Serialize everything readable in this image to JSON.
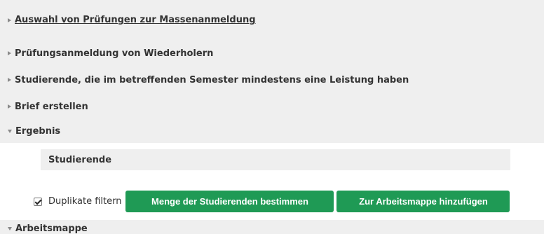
{
  "sections": [
    {
      "label": "Auswahl von Prüfungen zur Massenanmeldung",
      "expanded": false
    },
    {
      "label": "Prüfungsanmeldung von Wiederholern",
      "expanded": false
    },
    {
      "label": "Studierende, die im betreffenden Semester mindestens eine Leistung haben",
      "expanded": false
    },
    {
      "label": "Brief erstellen",
      "expanded": false
    },
    {
      "label": "Ergebnis",
      "expanded": true
    },
    {
      "label": "Arbeitsmappe",
      "expanded": true
    }
  ],
  "result": {
    "panel_label": "Studierende"
  },
  "controls": {
    "duplicate_filter_label": "Duplikate filtern",
    "duplicate_filter_checked": true,
    "determine_button": "Menge der Studierenden bestimmen",
    "add_to_workbook_button": "Zur Arbeitsmappe hinzufügen"
  },
  "colors": {
    "button_green": "#1f9a55",
    "section_background": "#efefef",
    "arrow_gray": "#8a8a8a",
    "text": "#333333"
  },
  "icons": {
    "collapsed": "triangle-right-icon",
    "expanded": "triangle-down-icon",
    "checkbox": "checkbox-checked-icon"
  }
}
